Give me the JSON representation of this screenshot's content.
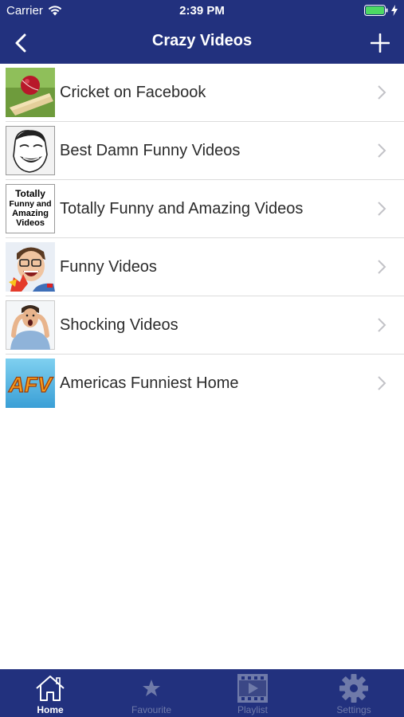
{
  "status_bar": {
    "carrier": "Carrier",
    "time": "2:39 PM"
  },
  "nav": {
    "title": "Crazy Videos",
    "back_icon": "chevron-left-icon",
    "add_icon": "plus-icon"
  },
  "items": [
    {
      "label": "Cricket on Facebook",
      "thumb": "cricket-ball-thumbnail"
    },
    {
      "label": "Best Damn Funny Videos",
      "thumb": "meme-face-thumbnail"
    },
    {
      "label": "Totally Funny and Amazing Videos",
      "thumb": "text-thumbnail",
      "thumb_text": "Totally Funny and Amazing Videos"
    },
    {
      "label": "Funny Videos",
      "thumb": "laughing-man-thumbnail"
    },
    {
      "label": "Shocking Videos",
      "thumb": "shocked-man-thumbnail"
    },
    {
      "label": "Americas Funniest Home",
      "thumb": "afv-logo-thumbnail",
      "thumb_text": "AFV"
    }
  ],
  "tabs": [
    {
      "label": "Home",
      "icon": "house-icon",
      "active": true
    },
    {
      "label": "Favourite",
      "icon": "star-icon",
      "active": false
    },
    {
      "label": "Playlist",
      "icon": "playlist-icon",
      "active": false
    },
    {
      "label": "Settings",
      "icon": "gear-icon",
      "active": false
    }
  ],
  "colors": {
    "primary": "#22317e",
    "tab_active": "#ffffff",
    "tab_inactive": "#6f7aa9",
    "battery": "#4cd964"
  }
}
